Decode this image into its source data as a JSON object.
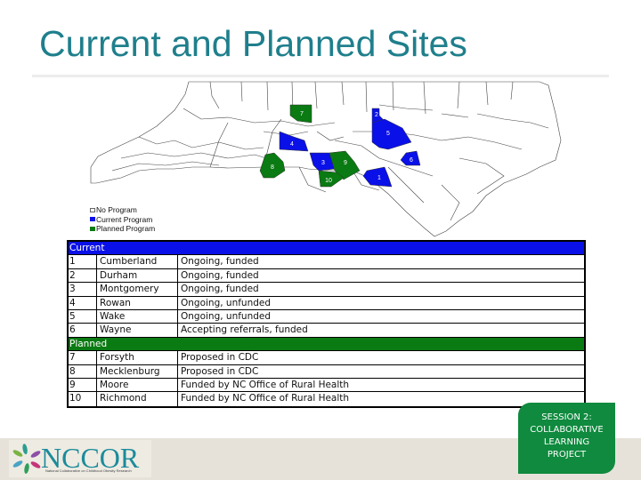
{
  "slide": {
    "title": "Current and Planned Sites"
  },
  "colors": {
    "title": "#1f7f8c",
    "current_program": "#0a10e8",
    "planned_program": "#0a7a12",
    "no_program": "#ffffff",
    "badge": "#0f8a3e",
    "footer": "#e6e2d9"
  },
  "map": {
    "region": "North Carolina counties",
    "legend": [
      {
        "label": "No Program",
        "type": "none"
      },
      {
        "label": "Current Program",
        "type": "current"
      },
      {
        "label": "Planned Program",
        "type": "planned"
      }
    ],
    "markers": [
      {
        "num": "1",
        "county": "Cumberland",
        "type": "current"
      },
      {
        "num": "2",
        "county": "Durham",
        "type": "current"
      },
      {
        "num": "3",
        "county": "Montgomery",
        "type": "current"
      },
      {
        "num": "4",
        "county": "Rowan",
        "type": "current"
      },
      {
        "num": "5",
        "county": "Wake",
        "type": "current"
      },
      {
        "num": "6",
        "county": "Wayne",
        "type": "current"
      },
      {
        "num": "7",
        "county": "Forsyth",
        "type": "planned"
      },
      {
        "num": "8",
        "county": "Mecklenburg",
        "type": "planned"
      },
      {
        "num": "9",
        "county": "Moore",
        "type": "planned"
      },
      {
        "num": "10",
        "county": "Richmond",
        "type": "planned"
      }
    ]
  },
  "table": {
    "current_header": "Current",
    "current_rows": [
      {
        "num": "1",
        "county": "Cumberland",
        "status": "Ongoing, funded"
      },
      {
        "num": "2",
        "county": "Durham",
        "status": "Ongoing, funded"
      },
      {
        "num": "3",
        "county": "Montgomery",
        "status": "Ongoing, funded"
      },
      {
        "num": "4",
        "county": "Rowan",
        "status": "Ongoing, unfunded"
      },
      {
        "num": "5",
        "county": "Wake",
        "status": "Ongoing, unfunded"
      },
      {
        "num": "6",
        "county": "Wayne",
        "status": "Accepting referrals, funded"
      }
    ],
    "planned_header": "Planned",
    "planned_rows": [
      {
        "num": "7",
        "county": "Forsyth",
        "status": "Proposed in CDC"
      },
      {
        "num": "8",
        "county": "Mecklenburg",
        "status": "Proposed in CDC"
      },
      {
        "num": "9",
        "county": "Moore",
        "status": "Funded by NC Office of Rural Health"
      },
      {
        "num": "10",
        "county": "Richmond",
        "status": "Funded by NC Office of Rural Health"
      }
    ]
  },
  "footer": {
    "logo_text": "NCCOR",
    "logo_tagline": "National Collaborative on Childhood Obesity Research",
    "badge_lines": [
      "SESSION 2:",
      "COLLABORATIVE",
      "LEARNING",
      "PROJECT"
    ]
  }
}
